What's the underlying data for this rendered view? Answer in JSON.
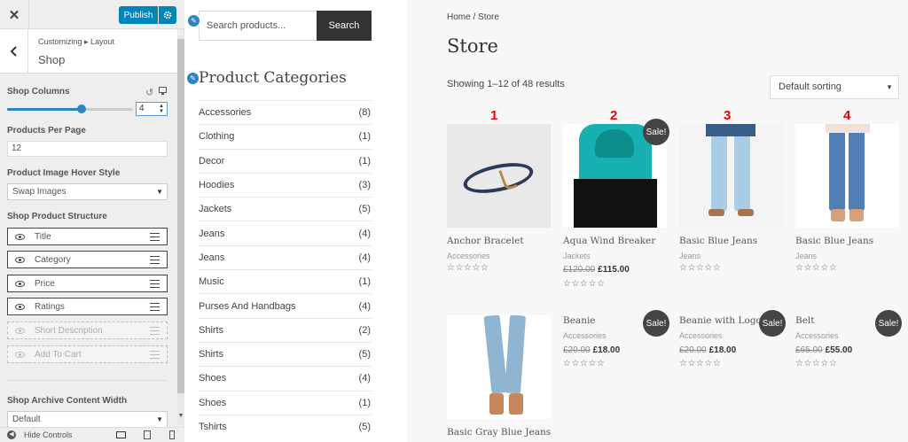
{
  "customizer": {
    "close": "✕",
    "publish_label": "Publish",
    "breadcrumb": "Customizing ▸ Layout",
    "section_title": "Shop",
    "shop_columns_label": "Shop Columns",
    "shop_columns_value": "4",
    "products_per_page_label": "Products Per Page",
    "products_per_page_value": "12",
    "hover_style_label": "Product Image Hover Style",
    "hover_style_value": "Swap Images",
    "structure_label": "Shop Product Structure",
    "structure_items": [
      {
        "label": "Title",
        "enabled": true
      },
      {
        "label": "Category",
        "enabled": true
      },
      {
        "label": "Price",
        "enabled": true
      },
      {
        "label": "Ratings",
        "enabled": true
      },
      {
        "label": "Short Description",
        "enabled": false
      },
      {
        "label": "Add To Cart",
        "enabled": false
      }
    ],
    "archive_width_label": "Shop Archive Content Width",
    "archive_width_value": "Default",
    "hide_controls": "Hide Controls",
    "accent_color": "#0085ba"
  },
  "sidebar": {
    "search_placeholder": "Search products...",
    "search_button": "Search",
    "categories_heading": "Product Categories",
    "categories": [
      {
        "name": "Accessories",
        "count": "(8)"
      },
      {
        "name": "Clothing",
        "count": "(1)"
      },
      {
        "name": "Decor",
        "count": "(1)"
      },
      {
        "name": "Hoodies",
        "count": "(3)"
      },
      {
        "name": "Jackets",
        "count": "(5)"
      },
      {
        "name": "Jeans",
        "count": "(4)"
      },
      {
        "name": "Jeans",
        "count": "(4)"
      },
      {
        "name": "Music",
        "count": "(1)"
      },
      {
        "name": "Purses And Handbags",
        "count": "(4)"
      },
      {
        "name": "Shirts",
        "count": "(2)"
      },
      {
        "name": "Shirts",
        "count": "(5)"
      },
      {
        "name": "Shoes",
        "count": "(4)"
      },
      {
        "name": "Shoes",
        "count": "(1)"
      },
      {
        "name": "Tshirts",
        "count": "(5)"
      }
    ]
  },
  "shop": {
    "breadcrumb_home": "Home",
    "breadcrumb_sep": " / ",
    "breadcrumb_current": "Store",
    "title": "Store",
    "result_count": "Showing 1–12 of 48 results",
    "sorting": "Default sorting",
    "sale_label": "Sale!",
    "stars": "☆☆☆☆☆",
    "annotations": [
      "1",
      "2",
      "3",
      "4"
    ],
    "products": [
      {
        "name": "Anchor Bracelet",
        "category": "Accessories",
        "old_price": "",
        "price": "",
        "sale": false
      },
      {
        "name": "Aqua Wind Breaker",
        "category": "Jackets",
        "old_price": "£120.00",
        "price": "£115.00",
        "sale": true
      },
      {
        "name": "Basic Blue Jeans",
        "category": "Jeans",
        "old_price": "",
        "price": "",
        "sale": false
      },
      {
        "name": "Basic Blue Jeans",
        "category": "Jeans",
        "old_price": "",
        "price": "",
        "sale": false
      },
      {
        "name": "Basic Gray Blue Jeans",
        "category": "",
        "old_price": "",
        "price": "",
        "sale": false
      },
      {
        "name": "Beanie",
        "category": "Accessories",
        "old_price": "£20.00",
        "price": "£18.00",
        "sale": true
      },
      {
        "name": "Beanie with Logo",
        "category": "Accessories",
        "old_price": "£20.00",
        "price": "£18.00",
        "sale": true
      },
      {
        "name": "Belt",
        "category": "Accessories",
        "old_price": "£65.00",
        "price": "£55.00",
        "sale": true
      }
    ]
  }
}
